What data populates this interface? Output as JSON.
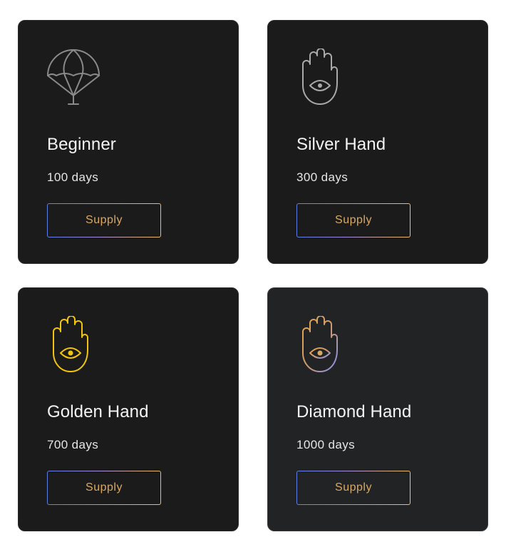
{
  "tiers": [
    {
      "title": "Beginner",
      "duration": "100 days",
      "button_label": "Supply",
      "icon": "parachute-icon",
      "icon_color": "#8a8a8a"
    },
    {
      "title": "Silver Hand",
      "duration": "300 days",
      "button_label": "Supply",
      "icon": "hamsa-hand-icon",
      "icon_color": "#a9a9a9"
    },
    {
      "title": "Golden Hand",
      "duration": "700 days",
      "button_label": "Supply",
      "icon": "hamsa-hand-icon",
      "icon_color": "#f2c40f"
    },
    {
      "title": "Diamond Hand",
      "duration": "1000 days",
      "button_label": "Supply",
      "icon": "hamsa-hand-icon",
      "icon_color": "gradient #e8a445 → #7f8ff0"
    }
  ],
  "colors": {
    "card_bg": "#1b1b1b",
    "card_bg_highlight": "#222325",
    "button_text": "#d9a863",
    "button_border_gradient": [
      "#5f7fe6",
      "#a98fe0",
      "#f0c05a"
    ]
  }
}
